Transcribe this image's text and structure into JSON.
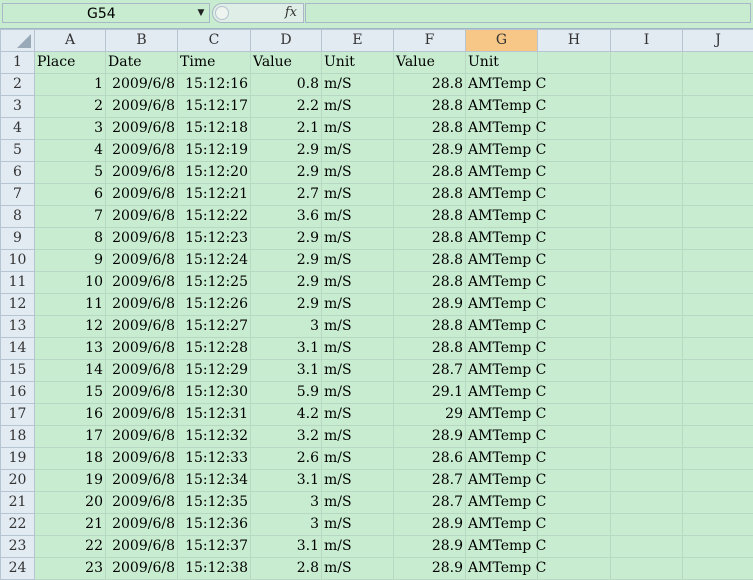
{
  "formula_bar": {
    "name_box": "G54",
    "fx_label": "fx"
  },
  "columns": [
    "A",
    "B",
    "C",
    "D",
    "E",
    "F",
    "G",
    "H",
    "I",
    "J"
  ],
  "selected_column": "G",
  "header_row": {
    "row_num": "1",
    "cells": [
      "Place",
      "Date",
      "Time",
      "Value",
      "Unit",
      "",
      "Value",
      "Unit",
      "",
      "",
      ""
    ]
  },
  "rows": [
    {
      "n": "2",
      "place": "1",
      "date": "2009/6/8",
      "time": "15:12:16",
      "v1": "0.8",
      "u1": "m/S",
      "v2": "28.8",
      "u2": "AMTemp C"
    },
    {
      "n": "3",
      "place": "2",
      "date": "2009/6/8",
      "time": "15:12:17",
      "v1": "2.2",
      "u1": "m/S",
      "v2": "28.8",
      "u2": "AMTemp C"
    },
    {
      "n": "4",
      "place": "3",
      "date": "2009/6/8",
      "time": "15:12:18",
      "v1": "2.1",
      "u1": "m/S",
      "v2": "28.8",
      "u2": "AMTemp C"
    },
    {
      "n": "5",
      "place": "4",
      "date": "2009/6/8",
      "time": "15:12:19",
      "v1": "2.9",
      "u1": "m/S",
      "v2": "28.9",
      "u2": "AMTemp C"
    },
    {
      "n": "6",
      "place": "5",
      "date": "2009/6/8",
      "time": "15:12:20",
      "v1": "2.9",
      "u1": "m/S",
      "v2": "28.8",
      "u2": "AMTemp C"
    },
    {
      "n": "7",
      "place": "6",
      "date": "2009/6/8",
      "time": "15:12:21",
      "v1": "2.7",
      "u1": "m/S",
      "v2": "28.8",
      "u2": "AMTemp C"
    },
    {
      "n": "8",
      "place": "7",
      "date": "2009/6/8",
      "time": "15:12:22",
      "v1": "3.6",
      "u1": "m/S",
      "v2": "28.8",
      "u2": "AMTemp C"
    },
    {
      "n": "9",
      "place": "8",
      "date": "2009/6/8",
      "time": "15:12:23",
      "v1": "2.9",
      "u1": "m/S",
      "v2": "28.8",
      "u2": "AMTemp C"
    },
    {
      "n": "10",
      "place": "9",
      "date": "2009/6/8",
      "time": "15:12:24",
      "v1": "2.9",
      "u1": "m/S",
      "v2": "28.8",
      "u2": "AMTemp C"
    },
    {
      "n": "11",
      "place": "10",
      "date": "2009/6/8",
      "time": "15:12:25",
      "v1": "2.9",
      "u1": "m/S",
      "v2": "28.8",
      "u2": "AMTemp C"
    },
    {
      "n": "12",
      "place": "11",
      "date": "2009/6/8",
      "time": "15:12:26",
      "v1": "2.9",
      "u1": "m/S",
      "v2": "28.9",
      "u2": "AMTemp C"
    },
    {
      "n": "13",
      "place": "12",
      "date": "2009/6/8",
      "time": "15:12:27",
      "v1": "3",
      "u1": "m/S",
      "v2": "28.8",
      "u2": "AMTemp C"
    },
    {
      "n": "14",
      "place": "13",
      "date": "2009/6/8",
      "time": "15:12:28",
      "v1": "3.1",
      "u1": "m/S",
      "v2": "28.8",
      "u2": "AMTemp C"
    },
    {
      "n": "15",
      "place": "14",
      "date": "2009/6/8",
      "time": "15:12:29",
      "v1": "3.1",
      "u1": "m/S",
      "v2": "28.7",
      "u2": "AMTemp C"
    },
    {
      "n": "16",
      "place": "15",
      "date": "2009/6/8",
      "time": "15:12:30",
      "v1": "5.9",
      "u1": "m/S",
      "v2": "29.1",
      "u2": "AMTemp C"
    },
    {
      "n": "17",
      "place": "16",
      "date": "2009/6/8",
      "time": "15:12:31",
      "v1": "4.2",
      "u1": "m/S",
      "v2": "29",
      "u2": "AMTemp C"
    },
    {
      "n": "18",
      "place": "17",
      "date": "2009/6/8",
      "time": "15:12:32",
      "v1": "3.2",
      "u1": "m/S",
      "v2": "28.9",
      "u2": "AMTemp C"
    },
    {
      "n": "19",
      "place": "18",
      "date": "2009/6/8",
      "time": "15:12:33",
      "v1": "2.6",
      "u1": "m/S",
      "v2": "28.6",
      "u2": "AMTemp C"
    },
    {
      "n": "20",
      "place": "19",
      "date": "2009/6/8",
      "time": "15:12:34",
      "v1": "3.1",
      "u1": "m/S",
      "v2": "28.7",
      "u2": "AMTemp C"
    },
    {
      "n": "21",
      "place": "20",
      "date": "2009/6/8",
      "time": "15:12:35",
      "v1": "3",
      "u1": "m/S",
      "v2": "28.7",
      "u2": "AMTemp C"
    },
    {
      "n": "22",
      "place": "21",
      "date": "2009/6/8",
      "time": "15:12:36",
      "v1": "3",
      "u1": "m/S",
      "v2": "28.9",
      "u2": "AMTemp C"
    },
    {
      "n": "23",
      "place": "22",
      "date": "2009/6/8",
      "time": "15:12:37",
      "v1": "3.1",
      "u1": "m/S",
      "v2": "28.9",
      "u2": "AMTemp C"
    },
    {
      "n": "24",
      "place": "23",
      "date": "2009/6/8",
      "time": "15:12:38",
      "v1": "2.8",
      "u1": "m/S",
      "v2": "28.9",
      "u2": "AMTemp C"
    }
  ],
  "colors": {
    "cell_background": "#c8ecd0",
    "header_background": "#e2eaf2",
    "selected_header": "#f6c787"
  }
}
